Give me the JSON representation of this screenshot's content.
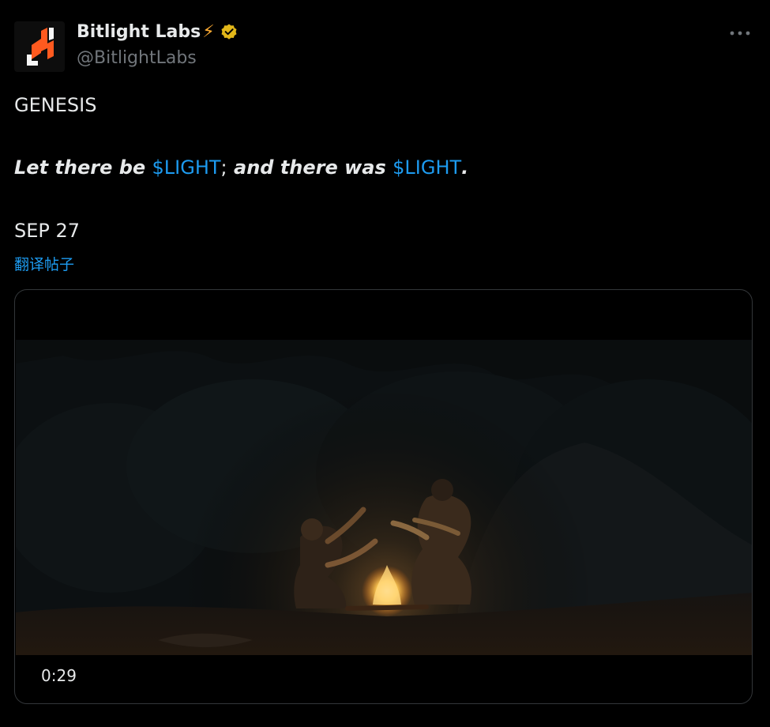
{
  "author": {
    "display_name": "Bitlight Labs",
    "name_emoji": "⚡",
    "handle": "@BitlightLabs",
    "verified_color": "#e2b719"
  },
  "tweet": {
    "line1": "GENESIS",
    "line2": {
      "part1": "Let there be ",
      "cashtag1": "$LIGHT",
      "sep": ";",
      "part2": " and there was ",
      "cashtag2": "$LIGHT",
      "end": "."
    },
    "line3": "SEP 27",
    "translate_label": "翻译帖子"
  },
  "media": {
    "duration": "0:29"
  },
  "colors": {
    "background": "#000000",
    "text": "#e7e9ea",
    "secondary": "#71767b",
    "link": "#1d9bf0",
    "brand_orange": "#ff5a1f"
  }
}
